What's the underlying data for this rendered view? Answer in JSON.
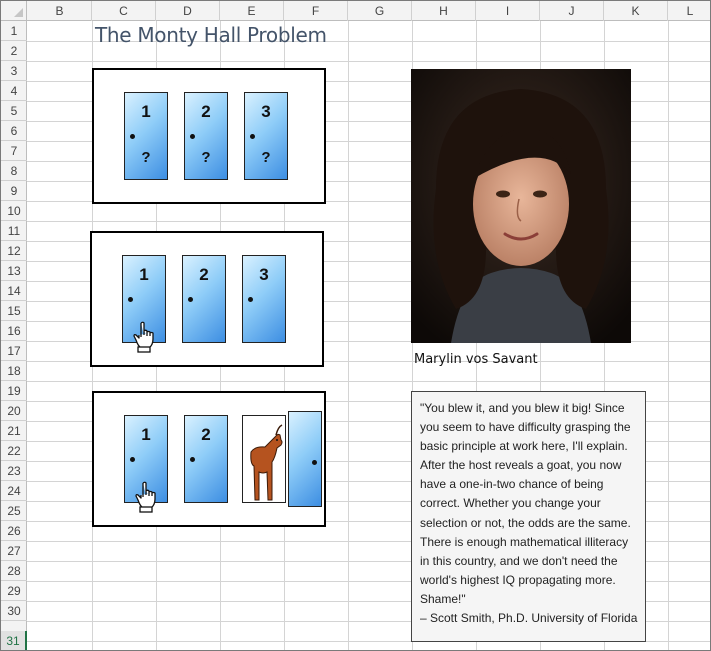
{
  "spreadsheet": {
    "columns": [
      "B",
      "C",
      "D",
      "E",
      "F",
      "G",
      "H",
      "I",
      "J",
      "K",
      "L"
    ],
    "rows": [
      "1",
      "2",
      "3",
      "4",
      "5",
      "6",
      "7",
      "8",
      "9",
      "10",
      "11",
      "12",
      "13",
      "14",
      "15",
      "16",
      "17",
      "18",
      "19",
      "20",
      "21",
      "22",
      "23",
      "24",
      "25",
      "26",
      "27",
      "28",
      "29",
      "30",
      "31"
    ],
    "active_row": "31"
  },
  "title": "The Monty Hall Problem",
  "panels": [
    {
      "doors": [
        {
          "number": "1",
          "mark": "?"
        },
        {
          "number": "2",
          "mark": "?"
        },
        {
          "number": "3",
          "mark": "?"
        }
      ]
    },
    {
      "doors": [
        {
          "number": "1"
        },
        {
          "number": "2"
        },
        {
          "number": "3"
        }
      ],
      "selected_door": "1"
    },
    {
      "doors": [
        {
          "number": "1"
        },
        {
          "number": "2"
        }
      ],
      "selected_door": "1",
      "revealed": "goat"
    }
  ],
  "photo": {
    "subject": "portrait-photo",
    "caption": "Marylin vos Savant"
  },
  "quote": {
    "text": "\"You blew it, and you blew it big! Since you seem to have difficulty grasping the basic principle at work here, I'll explain. After the host reveals a goat, you now have a one-in-two chance of being correct. Whether you change your selection or not, the odds are the same. There is enough mathematical illiteracy in this country, and we don't need the world's highest IQ propagating more. Shame!\"\n– Scott Smith, Ph.D. University of Florida"
  },
  "colors": {
    "title": "#44546a",
    "door_light": "#d9f1ff",
    "door_dark": "#3d8ee2",
    "active_header": "#217346",
    "goat": "#b5531f"
  },
  "icons": [
    "pointing-hand-icon",
    "goat-icon",
    "door-knob-icon"
  ]
}
